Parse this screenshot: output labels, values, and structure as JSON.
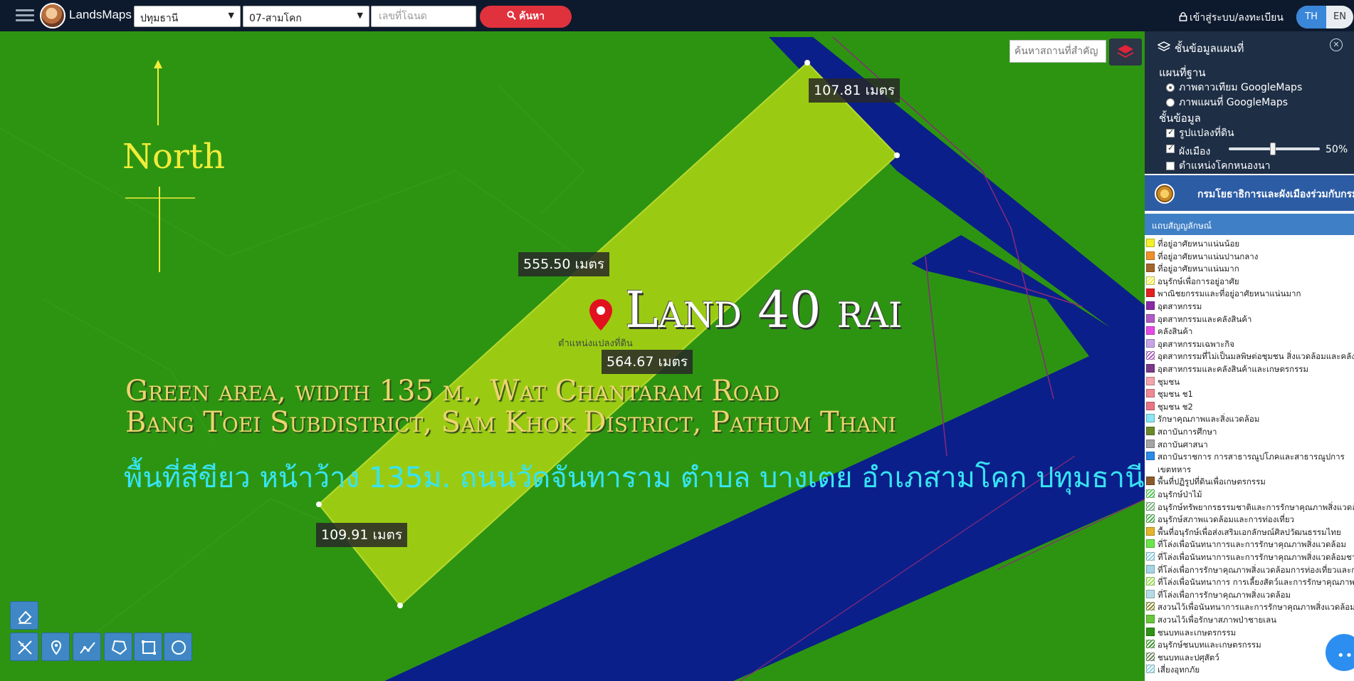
{
  "topbar": {
    "brand": "LandsMaps",
    "province": "ปทุมธานี",
    "district": "07-สามโคก",
    "deed_placeholder": "เลขที่โฉนด",
    "search_label": "ค้นหา",
    "login_label": "เข้าสู่ระบบ/ลงทะเบียน",
    "lang_th": "TH",
    "lang_en": "EN"
  },
  "map": {
    "north_label": "North",
    "parcel_title": "Land 40 rai",
    "parcel_position_label": "ตำแหน่งแปลงที่ดิน",
    "overlay_line1": "Green area, width 135 m., Wat Chantaram Road",
    "overlay_line2": "Bang Toei Subdistrict, Sam Khok District, Pathum Thani",
    "overlay_line_th": "พื้นที่สีขียว หน้าว้าง 135ม. ถนนวัดจันทาราม ตำบล บางเตย อำเภสามโคก ปทุมธานี",
    "measurements": [
      "107.81 เมตร",
      "555.50 เมตร",
      "564.67 เมตร",
      "109.91 เมตร"
    ],
    "place_search_placeholder": "ค้นหาสถานที่สำคัญ",
    "colors": {
      "green_zone": "#2d9412",
      "parcel": "#9acb12",
      "road": "#0b1f8a"
    }
  },
  "tools": [
    "eraser-icon",
    "measure-icon",
    "marker-icon",
    "polyline-icon",
    "polygon-icon",
    "rectangle-icon",
    "circle-icon"
  ],
  "panel": {
    "title": "ชั้นข้อมูลแผนที่",
    "basemap_heading": "แผนที่ฐาน",
    "basemap_options": [
      "ภาพดาวเทียม GoogleMaps",
      "ภาพแผนที่ GoogleMaps"
    ],
    "layers_heading": "ชั้นข้อมูล",
    "layer_options": [
      "รูปแปลงที่ดิน",
      "ผังเมือง",
      "ตำแหน่งโคกหนองนา"
    ],
    "opacity_value": "50%",
    "agency_name": "กรมโยธาธิการและผังเมืองร่วมกับกรมที่ดิน",
    "legend_heading": "แถบสัญญลักษณ์",
    "legend": [
      {
        "label": "ที่อยู่อาศัยหนาแน่นน้อย",
        "color": "#f4ef2a"
      },
      {
        "label": "ที่อยู่อาศัยหนาแน่นปานกลาง",
        "color": "#f0902a"
      },
      {
        "label": "ที่อยู่อาศัยหนาแน่นมาก",
        "color": "#a4642a"
      },
      {
        "label": "อนุรักษ์เพื่อการอยู่อาศัย",
        "color": "#f4ef2a",
        "hatch": true
      },
      {
        "label": "พาณิชยกรรมและที่อยู่อาศัยหนาแน่นมาก",
        "color": "#e52020"
      },
      {
        "label": "อุตสาหกรรม",
        "color": "#8a2aa4"
      },
      {
        "label": "อุตสาหกรรมและคลังสินค้า",
        "color": "#b25ac6"
      },
      {
        "label": "คลังสินค้า",
        "color": "#e64ae6"
      },
      {
        "label": "อุตสาหกรรมเฉพาะกิจ",
        "color": "#c6a4e6"
      },
      {
        "label": "อุตสาหกรรมที่ไม่เป็นมลพิษต่อชุมชน สิ่งแวดล้อมและคลังสินค้า",
        "color": "#b25ac6",
        "hatch": true
      },
      {
        "label": "อุตสาหกรรมและคลังสินค้าและเกษตรกรรม",
        "color": "#7a3a8a"
      },
      {
        "label": "ชุมชน",
        "color": "#f4a4ac"
      },
      {
        "label": "ชุมชน ช1",
        "color": "#ee8a94"
      },
      {
        "label": "ชุมชน ช2",
        "color": "#e87484"
      },
      {
        "label": "รักษาคุณภาพและสิ่งแวดล้อม",
        "color": "#8ae6f4"
      },
      {
        "label": "สถาบันการศึกษา",
        "color": "#6a8a2a"
      },
      {
        "label": "สถาบันศาสนา",
        "color": "#a4a4a4"
      },
      {
        "label": "สถาบันราชการ การสาธารณูปโภคและสาธารณูปการ",
        "color": "#2a8ae6"
      },
      {
        "label": "เขตทหาร",
        "color": ""
      },
      {
        "label": "พื้นที่ปฏิรูปที่ดินเพื่อเกษตรกรรม",
        "color": "#8a5a2a"
      },
      {
        "label": "อนุรักษ์ป่าไม้",
        "color": "#4ad44a",
        "hatch": true
      },
      {
        "label": "อนุรักษ์ทรัพยากรธรรมชาติและการรักษาคุณภาพสิ่งแวดล้อม",
        "color": "#7ab67a",
        "hatch": true
      },
      {
        "label": "อนุรักษ์สภาพแวดล้อมและการท่องเที่ยว",
        "color": "#4ab44a",
        "hatch": true
      },
      {
        "label": "พื้นที่อนุรักษ์เพื่อส่งเสริมเอกลักษณ์ศิลปวัฒนธรรมไทย",
        "color": "#e6b42a"
      },
      {
        "label": "ที่โล่งเพื่อนันทนาการและการรักษาคุณภาพสิ่งแวดล้อม",
        "color": "#6ae64a"
      },
      {
        "label": "ที่โล่งเพื่อนันทนาการและการรักษาคุณภาพสิ่งแวดล้อมชายฝั่ง",
        "color": "#8ad4e6",
        "hatch": true
      },
      {
        "label": "ที่โล่งเพื่อการรักษาคุณภาพสิ่งแวดล้อมการท่องเที่ยวและการ",
        "color": "#a4d4e6"
      },
      {
        "label": "ที่โล่งเพื่อนันทนาการ การเลี้ยงสัตว์และการรักษาคุณภาพสิ่งแ",
        "color": "#9ae64a",
        "hatch": true
      },
      {
        "label": "ที่โล่งเพื่อการรักษาคุณภาพสิ่งแวดล้อม",
        "color": "#b4dce6"
      },
      {
        "label": "สงวนไว้เพื่อนันทนาการและการรักษาคุณภาพสิ่งแวดล้อม",
        "color": "#8a8a2a",
        "hatch": true
      },
      {
        "label": "สงวนไว้เพื่อรักษาสภาพป่าชายเลน",
        "color": "#6ac63a"
      },
      {
        "label": "ชนบทและเกษตรกรรม",
        "color": "#2e9414"
      },
      {
        "label": "อนุรักษ์ชนบทและเกษตรกรรม",
        "color": "#3a9a2a",
        "hatch": true
      },
      {
        "label": "ชนบทและปศุสัตว์",
        "color": "#6a8a5a",
        "hatch": true
      },
      {
        "label": "เสี่ยงอุทกภัย",
        "color": "#8ad4e6",
        "hatch": true
      }
    ]
  }
}
